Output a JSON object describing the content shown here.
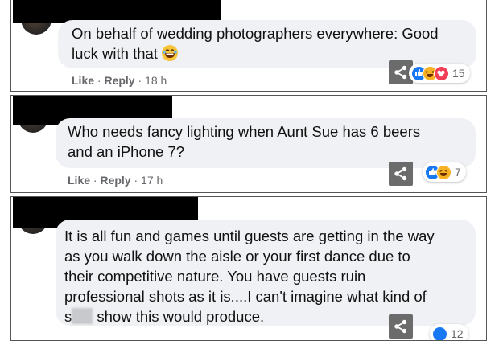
{
  "comments": [
    {
      "text": "On behalf of wedding photographers everywhere: Good luck with that",
      "text_line1": "On behalf of wedding photographers everywhere: Good",
      "text_line2": "luck with that",
      "emoji": "laughing-emoji",
      "like_label": "Like",
      "reply_label": "Reply",
      "timestamp": "18 h",
      "reaction_count": "15",
      "reactions": [
        "like",
        "haha",
        "care"
      ]
    },
    {
      "text_line1": "Who needs fancy lighting when Aunt Sue has 6 beers",
      "text_line2": "and an iPhone 7?",
      "like_label": "Like",
      "reply_label": "Reply",
      "timestamp": "17 h",
      "reaction_count": "7",
      "reactions": [
        "like",
        "haha"
      ]
    },
    {
      "text_line1": "It is all fun and games until guests are getting in the way",
      "text_line2": "as you walk down the aisle or your first dance due to",
      "text_line3": "their competitive nature. You have guests ruin",
      "text_line4": "professional shots as it is....I can't imagine what kind of",
      "text_line5_prefix": "s",
      "text_line5_suffix": " show this would produce.",
      "reaction_count": "12",
      "reactions": [
        "like"
      ]
    }
  ],
  "separator": "·",
  "colors": {
    "bubble": "#eff1f4",
    "meta_text": "#65676b",
    "like_blue": "#1877f2",
    "haha_yellow": "#f7b125",
    "care_red": "#f33e58",
    "share_gray": "#6b6b6b"
  },
  "icons": {
    "share": "share-icon",
    "like": "like-reaction-icon",
    "haha": "haha-reaction-icon",
    "care": "heart-reaction-icon"
  }
}
